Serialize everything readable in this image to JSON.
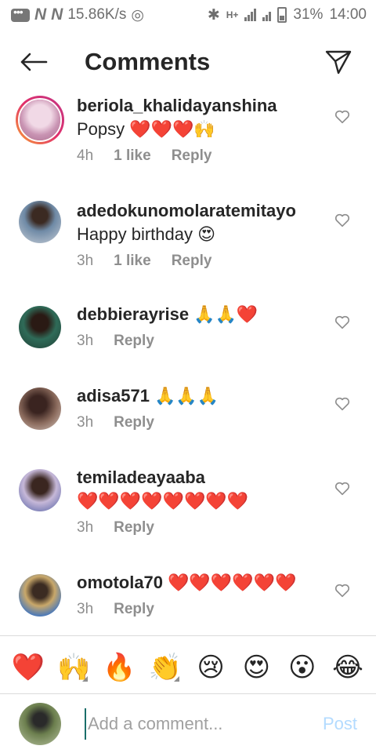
{
  "status_bar": {
    "speed": "15.86K/s",
    "network": "H+",
    "battery": "31%",
    "time": "14:00"
  },
  "header": {
    "title": "Comments"
  },
  "comments": [
    {
      "username": "beriola_khalidayanshina",
      "text": "Popsy ❤️❤️❤️🙌",
      "time": "4h",
      "likes": "1 like",
      "reply": "Reply",
      "avatar_color": "#c9a0b8"
    },
    {
      "username": "adedokunomolaratemitayo",
      "text": "Happy birthday 😍",
      "time": "3h",
      "likes": "1 like",
      "reply": "Reply",
      "avatar_color": "#5a6b7a"
    },
    {
      "username": "debbierayrise",
      "text": "🙏🙏❤️",
      "time": "3h",
      "likes": "",
      "reply": "Reply",
      "avatar_color": "#2f5a45"
    },
    {
      "username": "adisa571",
      "text": "🙏🙏🙏",
      "time": "3h",
      "likes": "",
      "reply": "Reply",
      "avatar_color": "#6b4a3a"
    },
    {
      "username": "temiladeayaaba",
      "text": "❤️❤️❤️❤️❤️❤️❤️❤️",
      "time": "3h",
      "likes": "",
      "reply": "Reply",
      "avatar_color": "#3d4a8a"
    },
    {
      "username": "omotola70",
      "text": "❤️❤️❤️❤️❤️❤️",
      "time": "3h",
      "likes": "",
      "reply": "Reply",
      "avatar_color": "#8a7a5a"
    }
  ],
  "emoji_bar": [
    {
      "glyph": "❤️",
      "name": "heart"
    },
    {
      "glyph": "🙌",
      "name": "raised-hands"
    },
    {
      "glyph": "🔥",
      "name": "fire"
    },
    {
      "glyph": "👏",
      "name": "clapping-hands"
    },
    {
      "glyph": "😢",
      "name": "crying-face"
    },
    {
      "glyph": "😍",
      "name": "heart-eyes"
    },
    {
      "glyph": "😮",
      "name": "surprised-face"
    },
    {
      "glyph": "😂",
      "name": "tears-of-joy"
    }
  ],
  "composer": {
    "placeholder": "Add a comment...",
    "post_label": "Post"
  },
  "colors": {
    "heart": "#e0548e",
    "post_disabled": "#b3dbff",
    "meta_gray": "#8e8e8e"
  }
}
